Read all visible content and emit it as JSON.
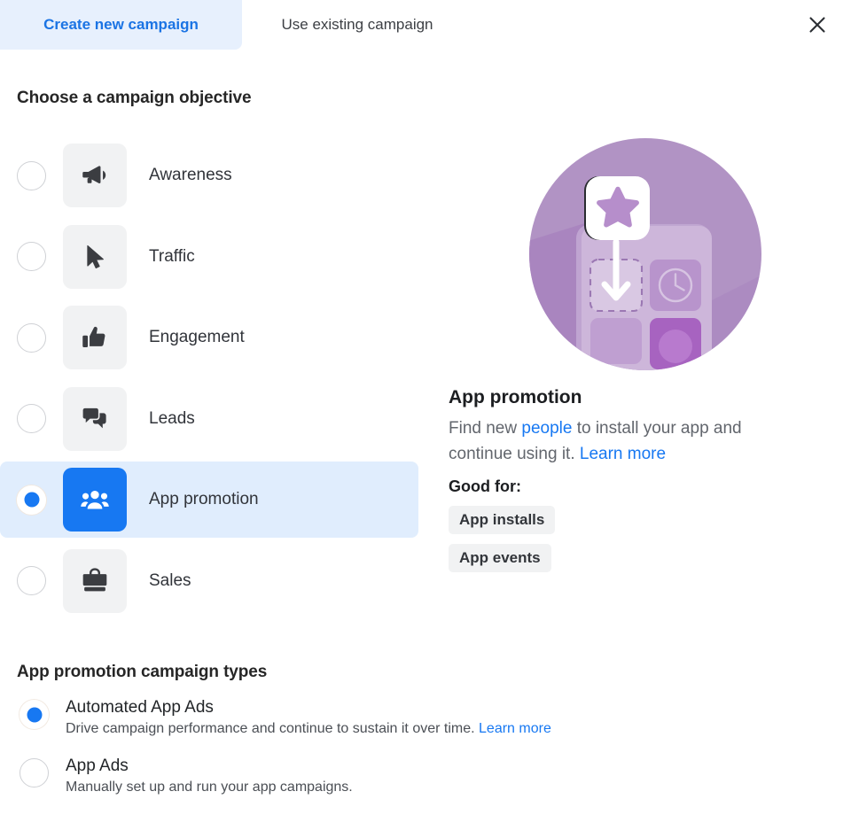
{
  "tabs": [
    {
      "label": "Create new campaign",
      "active": true
    },
    {
      "label": "Use existing campaign",
      "active": false
    }
  ],
  "close_icon": "close-icon",
  "objective_section": {
    "heading": "Choose a campaign objective",
    "options": [
      {
        "label": "Awareness",
        "icon": "megaphone-icon",
        "selected": false
      },
      {
        "label": "Traffic",
        "icon": "cursor-icon",
        "selected": false
      },
      {
        "label": "Engagement",
        "icon": "thumbs-up-icon",
        "selected": false
      },
      {
        "label": "Leads",
        "icon": "chat-bubbles-icon",
        "selected": false
      },
      {
        "label": "App promotion",
        "icon": "people-icon",
        "selected": true
      },
      {
        "label": "Sales",
        "icon": "shopping-bag-icon",
        "selected": false
      }
    ]
  },
  "info_panel": {
    "illustration": "app-install-illustration",
    "title": "App promotion",
    "description_part1": "Find new ",
    "description_link1": "people",
    "description_part2": " to install your app and continue using it. ",
    "description_link2": "Learn more",
    "good_for_label": "Good for:",
    "chips": [
      "App installs",
      "App events"
    ]
  },
  "campaign_types": {
    "heading": "App promotion campaign types",
    "options": [
      {
        "title": "Automated App Ads",
        "subtitle": "Drive campaign performance and continue to sustain it over time. ",
        "link": "Learn more",
        "selected": true
      },
      {
        "title": "App Ads",
        "subtitle": "Manually set up and run your app campaigns.",
        "link": "",
        "selected": false
      }
    ]
  },
  "colors": {
    "accent_blue": "#1778f2",
    "tab_active_bg": "#e7f0fd",
    "selected_row_bg": "#e0edfd",
    "tile_bg": "#f1f2f3",
    "illustration_purple": "#b193c4"
  }
}
